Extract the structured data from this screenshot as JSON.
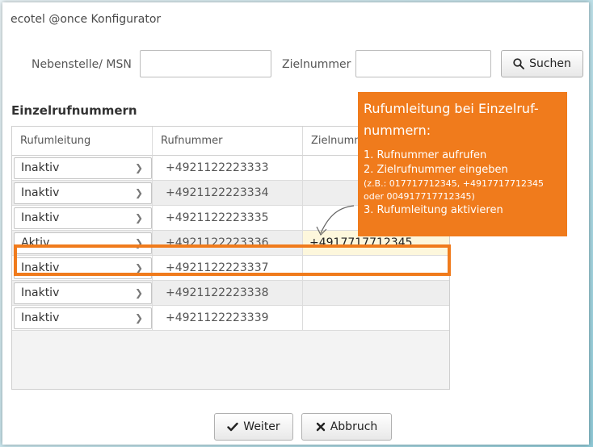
{
  "window": {
    "title": "ecotel @once Konfigurator"
  },
  "search": {
    "msn_label": "Nebenstelle/ MSN",
    "msn_value": "",
    "target_label": "Zielnummer",
    "target_value": "",
    "button_label": "Suchen",
    "button_icon": "search-icon"
  },
  "section": {
    "title": "Einzelrufnummern"
  },
  "table": {
    "columns": [
      "Rufumleitung",
      "Rufnummer",
      "Zielnumm"
    ],
    "rows": [
      {
        "status": "Inaktiv",
        "number": "+4921122223333",
        "target": ""
      },
      {
        "status": "Inaktiv",
        "number": "+4921122223334",
        "target": ""
      },
      {
        "status": "Inaktiv",
        "number": "+4921122223335",
        "target": ""
      },
      {
        "status": "Aktiv",
        "number": "+4921122223336",
        "target": "+4917717712345"
      },
      {
        "status": "Inaktiv",
        "number": "+4921122223337",
        "target": ""
      },
      {
        "status": "Inaktiv",
        "number": "+4921122223338",
        "target": ""
      },
      {
        "status": "Inaktiv",
        "number": "+4921122223339",
        "target": ""
      }
    ]
  },
  "callout": {
    "heading_1": "Rufumleitung bei Einzelruf-",
    "heading_2": "nummern:",
    "step_1": "1. Rufnummer aufrufen",
    "step_2": "2. Zielrufnummer eingeben",
    "example_1": "(z.B.: 017717712345, +4917717712345",
    "example_2": "oder 004917717712345)",
    "step_3": "3. Rufumleitung aktivieren"
  },
  "footer": {
    "next_label": "Weiter",
    "cancel_label": "Abbruch"
  },
  "colors": {
    "accent": "#f07b1c",
    "highlight_cell": "#fdf7dc",
    "background": "#bfe0e8"
  }
}
